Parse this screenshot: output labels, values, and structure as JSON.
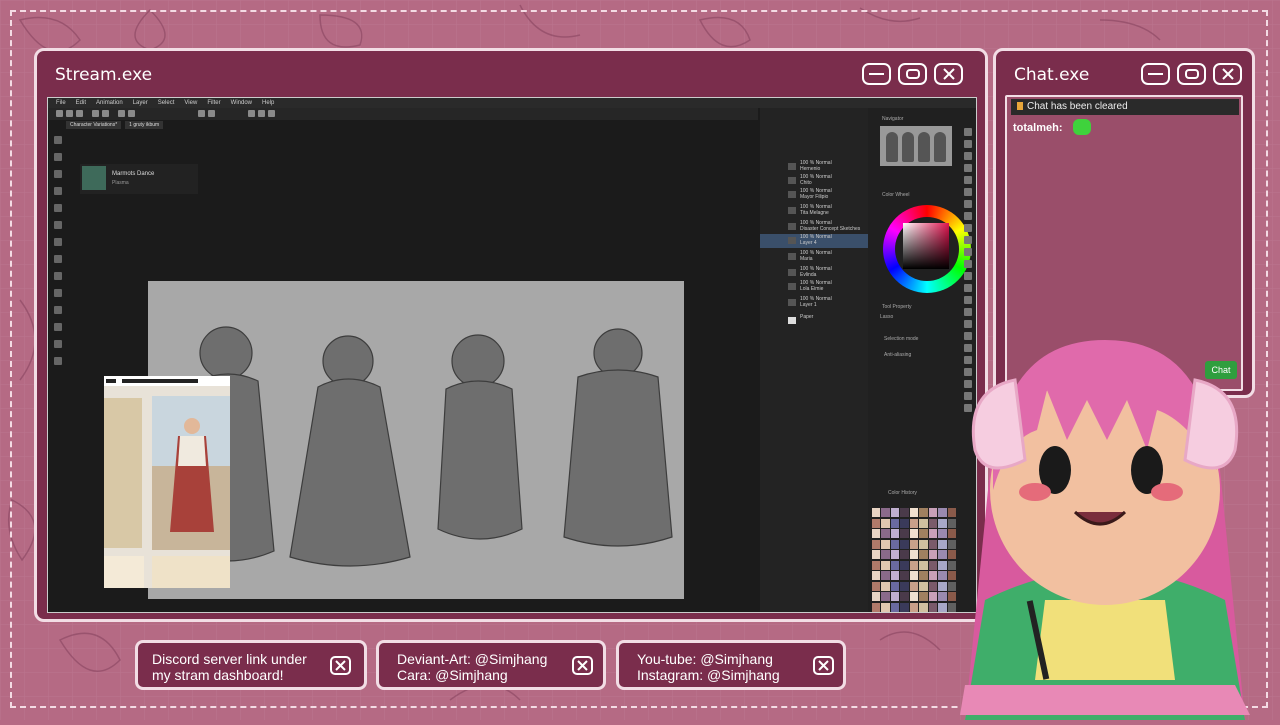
{
  "stream_window": {
    "title": "Stream.exe",
    "app": {
      "menu": [
        "File",
        "Edit",
        "Animation",
        "Layer",
        "Select",
        "View",
        "Filter",
        "Window",
        "Help"
      ],
      "tabs": [
        "Character Variations*",
        "1 gruty ikbum"
      ],
      "project": {
        "name": "Marmots Dance",
        "sub": "Plasma"
      },
      "layers": [
        {
          "mode": "100 % Normal",
          "name": "Hernenio"
        },
        {
          "mode": "100 % Normal",
          "name": "Chito"
        },
        {
          "mode": "100 % Normal",
          "name": "Mayor Filipio"
        },
        {
          "mode": "100 % Normal",
          "name": "Tita Melagne"
        },
        {
          "mode": "100 % Normal",
          "name": "Disaster Concept Sketches"
        },
        {
          "mode": "100 % Normal",
          "name": "Layer 4"
        },
        {
          "mode": "100 % Normal",
          "name": "Maria"
        },
        {
          "mode": "100 % Normal",
          "name": "Evlinda"
        },
        {
          "mode": "100 % Normal",
          "name": "Lola Eimie"
        },
        {
          "mode": "100 % Normal",
          "name": "Layer 1"
        },
        {
          "mode": "",
          "name": "Paper"
        }
      ],
      "panels": {
        "navigator": "Navigator",
        "color_wheel": "Color Wheel",
        "tool_property": "Tool Property",
        "lasso": "Lasso",
        "selection_mode": "Selection mode",
        "anti_aliasing": "Anti-aliasing",
        "color_history": "Color History"
      }
    }
  },
  "chat_window": {
    "title": "Chat.exe",
    "notice": "Chat has been cleared",
    "messages": [
      {
        "user": "totalmeh:",
        "emote": "green-blob-emote"
      }
    ],
    "chat_button": "Chat"
  },
  "info_bars": [
    {
      "line1": "Discord server link under",
      "line2": "my stram dashboard!"
    },
    {
      "line1": "Deviant-Art: @Simjhang",
      "line2": "Cara: @Simjhang"
    },
    {
      "line1": "You-tube: @Simjhang",
      "line2": "Instagram: @Simjhang"
    }
  ],
  "colors": {
    "frame_bg": "#b56a84",
    "window_fill": "#7a2d4c",
    "window_border": "#f2dde5",
    "chat_button": "#2f9e3e"
  },
  "icons": {
    "window_controls": [
      "minimize-icon",
      "maximize-icon",
      "close-icon"
    ],
    "info_close": "close-icon"
  }
}
